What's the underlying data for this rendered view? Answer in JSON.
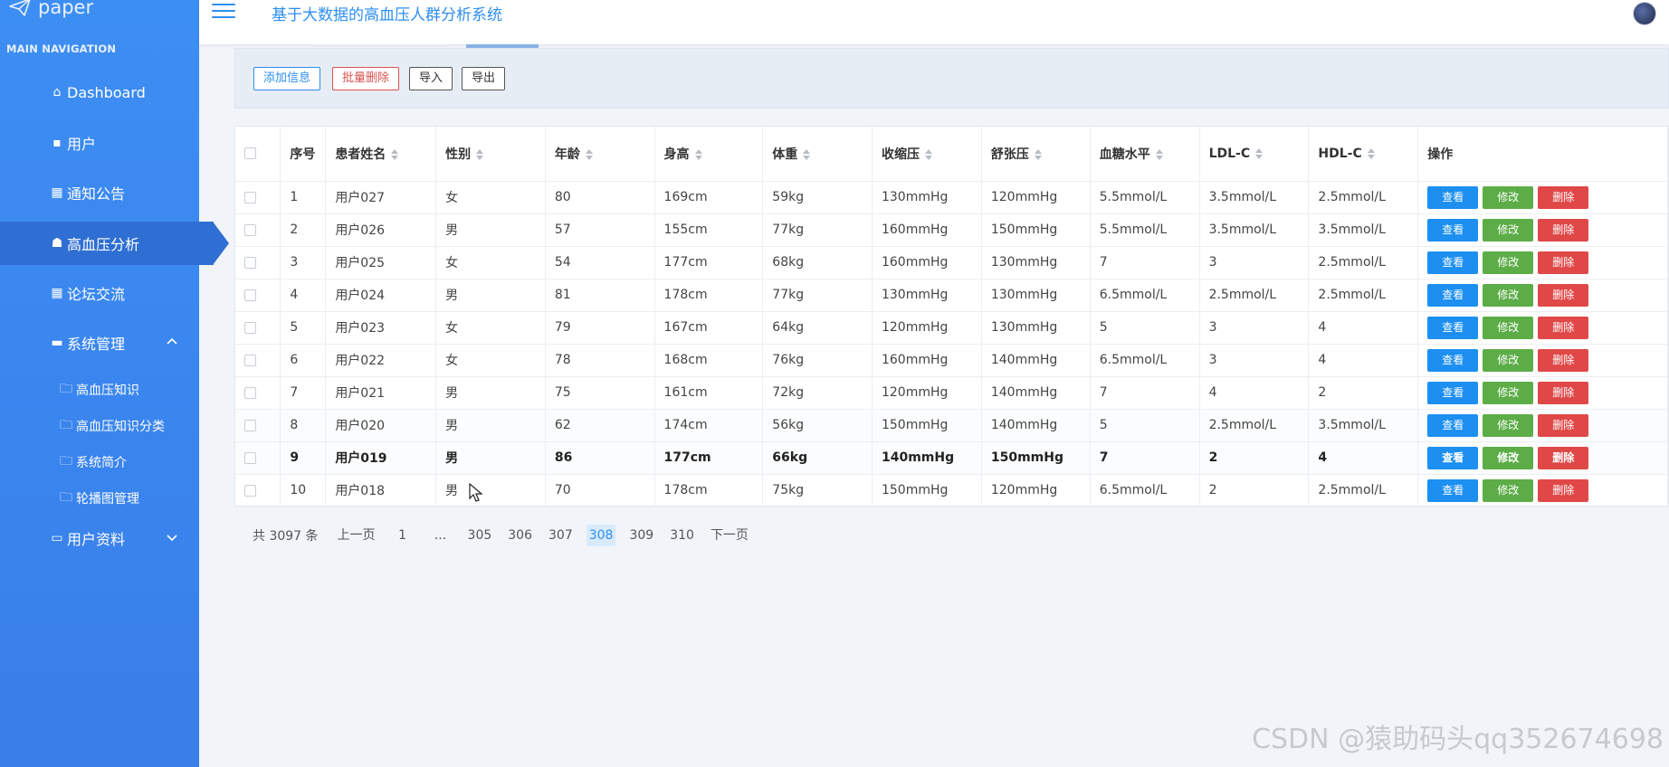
{
  "brand": {
    "name": "paper"
  },
  "header": {
    "title": "基于大数据的高血压人群分析系统"
  },
  "sidebar": {
    "caption": "MAIN NAVIGATION",
    "items": [
      {
        "label": "Dashboard"
      },
      {
        "label": "用户"
      },
      {
        "label": "通知公告"
      },
      {
        "label": "高血压分析"
      },
      {
        "label": "论坛交流"
      },
      {
        "label": "系统管理"
      },
      {
        "label": "用户资料"
      }
    ],
    "sub_items": [
      {
        "label": "高血压知识"
      },
      {
        "label": "高血压知识分类"
      },
      {
        "label": "系统简介"
      },
      {
        "label": "轮播图管理"
      }
    ]
  },
  "toolbar": {
    "add_label": "添加信息",
    "batch_delete_label": "批量删除",
    "import_label": "导入",
    "export_label": "导出"
  },
  "table": {
    "columns": [
      "序号",
      "患者姓名",
      "性别",
      "年龄",
      "身高",
      "体重",
      "收缩压",
      "舒张压",
      "血糖水平",
      "LDL-C",
      "HDL-C",
      "操作"
    ],
    "action_labels": {
      "view": "查看",
      "edit": "修改",
      "delete": "删除"
    },
    "rows": [
      [
        "1",
        "用户027",
        "女",
        "80",
        "169cm",
        "59kg",
        "130mmHg",
        "120mmHg",
        "5.5mmol/L",
        "3.5mmol/L",
        "2.5mmol/L"
      ],
      [
        "2",
        "用户026",
        "男",
        "57",
        "155cm",
        "77kg",
        "160mmHg",
        "150mmHg",
        "5.5mmol/L",
        "3.5mmol/L",
        "3.5mmol/L"
      ],
      [
        "3",
        "用户025",
        "女",
        "54",
        "177cm",
        "68kg",
        "160mmHg",
        "130mmHg",
        "7",
        "3",
        "2.5mmol/L"
      ],
      [
        "4",
        "用户024",
        "男",
        "81",
        "178cm",
        "77kg",
        "130mmHg",
        "130mmHg",
        "6.5mmol/L",
        "2.5mmol/L",
        "2.5mmol/L"
      ],
      [
        "5",
        "用户023",
        "女",
        "79",
        "167cm",
        "64kg",
        "120mmHg",
        "130mmHg",
        "5",
        "3",
        "4"
      ],
      [
        "6",
        "用户022",
        "女",
        "78",
        "168cm",
        "76kg",
        "160mmHg",
        "140mmHg",
        "6.5mmol/L",
        "3",
        "4"
      ],
      [
        "7",
        "用户021",
        "男",
        "75",
        "161cm",
        "72kg",
        "120mmHg",
        "140mmHg",
        "7",
        "4",
        "2"
      ],
      [
        "8",
        "用户020",
        "男",
        "62",
        "174cm",
        "56kg",
        "150mmHg",
        "140mmHg",
        "5",
        "2.5mmol/L",
        "3.5mmol/L"
      ],
      [
        "9",
        "用户019",
        "男",
        "86",
        "177cm",
        "66kg",
        "140mmHg",
        "150mmHg",
        "7",
        "2",
        "4"
      ],
      [
        "10",
        "用户018",
        "男",
        "70",
        "178cm",
        "75kg",
        "150mmHg",
        "120mmHg",
        "6.5mmol/L",
        "2",
        "2.5mmol/L"
      ]
    ]
  },
  "pagination": {
    "total": "共 3097 条",
    "prev": "上一页",
    "first": "1",
    "ellipsis": "...",
    "pages": [
      "305",
      "306",
      "307",
      "308",
      "309",
      "310"
    ],
    "current": "308",
    "next": "下一页"
  },
  "watermark": "CSDN @猿助码头qq352674698",
  "colors": {
    "sidebar": "#3b86ef",
    "sidebar_active": "#2f6fd3",
    "accent": "#2d8ef0",
    "view_button": "#1c8ff0",
    "edit_button": "#5cad47",
    "delete_button": "#e04848"
  }
}
